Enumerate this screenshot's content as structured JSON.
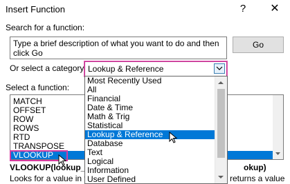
{
  "window": {
    "title": "Insert Function",
    "help_label": "?",
    "close_label": "✕"
  },
  "search": {
    "label": "Search for a function:",
    "value": "Type a brief description of what you want to do and then click Go",
    "go_label": "Go"
  },
  "category": {
    "label": "Or select a category:",
    "value": "Lookup & Reference",
    "options": [
      "Most Recently Used",
      "All",
      "Financial",
      "Date & Time",
      "Math & Trig",
      "Statistical",
      "Lookup & Reference",
      "Database",
      "Text",
      "Logical",
      "Information",
      "User Defined"
    ],
    "selected_index": 6
  },
  "functions": {
    "label": "Select a function:",
    "items": [
      "MATCH",
      "OFFSET",
      "ROW",
      "ROWS",
      "RTD",
      "TRANSPOSE",
      "VLOOKUP"
    ],
    "selected_index": 6
  },
  "signature_left": "VLOOKUP(lookup_va",
  "signature_right": "okup)",
  "description_left": "Looks for a value in t",
  "description_right": "returns a value",
  "colors": {
    "accent": "#0078d7",
    "highlight": "#d63aa0"
  }
}
